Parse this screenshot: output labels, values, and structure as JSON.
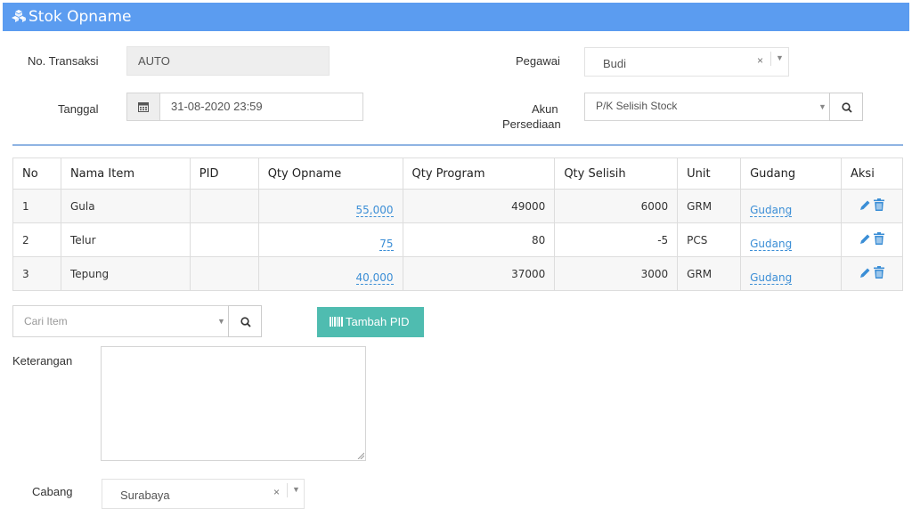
{
  "header": {
    "title": "Stok Opname"
  },
  "form": {
    "no_transaksi_label": "No. Transaksi",
    "no_transaksi_value": "AUTO",
    "tanggal_label": "Tanggal",
    "tanggal_value": "31-08-2020 23:59",
    "pegawai_label": "Pegawai",
    "pegawai_value": "Budi",
    "akun_label_1": "Akun",
    "akun_label_2": "Persediaan",
    "akun_value": "P/K Selisih Stock",
    "clear_glyph": "×",
    "caret_glyph": "▼"
  },
  "table": {
    "headers": [
      "No",
      "Nama Item",
      "PID",
      "Qty Opname",
      "Qty Program",
      "Qty Selisih",
      "Unit",
      "Gudang",
      "Aksi"
    ],
    "rows": [
      {
        "no": "1",
        "nama": "Gula",
        "pid": "",
        "qty_opname": "55,000",
        "qty_program": "49000",
        "qty_selisih": "6000",
        "unit": "GRM",
        "gudang": "Gudang"
      },
      {
        "no": "2",
        "nama": "Telur",
        "pid": "",
        "qty_opname": "75",
        "qty_program": "80",
        "qty_selisih": "-5",
        "unit": "PCS",
        "gudang": "Gudang"
      },
      {
        "no": "3",
        "nama": "Tepung",
        "pid": "",
        "qty_opname": "40,000",
        "qty_program": "37000",
        "qty_selisih": "3000",
        "unit": "GRM",
        "gudang": "Gudang"
      }
    ]
  },
  "search": {
    "placeholder": "Cari Item"
  },
  "tambah_pid_label": "Tambah PID",
  "keterangan": {
    "label": "Keterangan",
    "value": ""
  },
  "cabang": {
    "label": "Cabang",
    "value": "Surabaya"
  },
  "colors": {
    "header_bg": "#5b9cf0",
    "accent": "#3b8ed6",
    "teal_button": "#4fbcb0",
    "divider": "#8fb4e3"
  },
  "icons": [
    "cubes-icon",
    "calendar-icon",
    "search-icon",
    "pencil-icon",
    "trash-icon",
    "barcode-icon"
  ]
}
